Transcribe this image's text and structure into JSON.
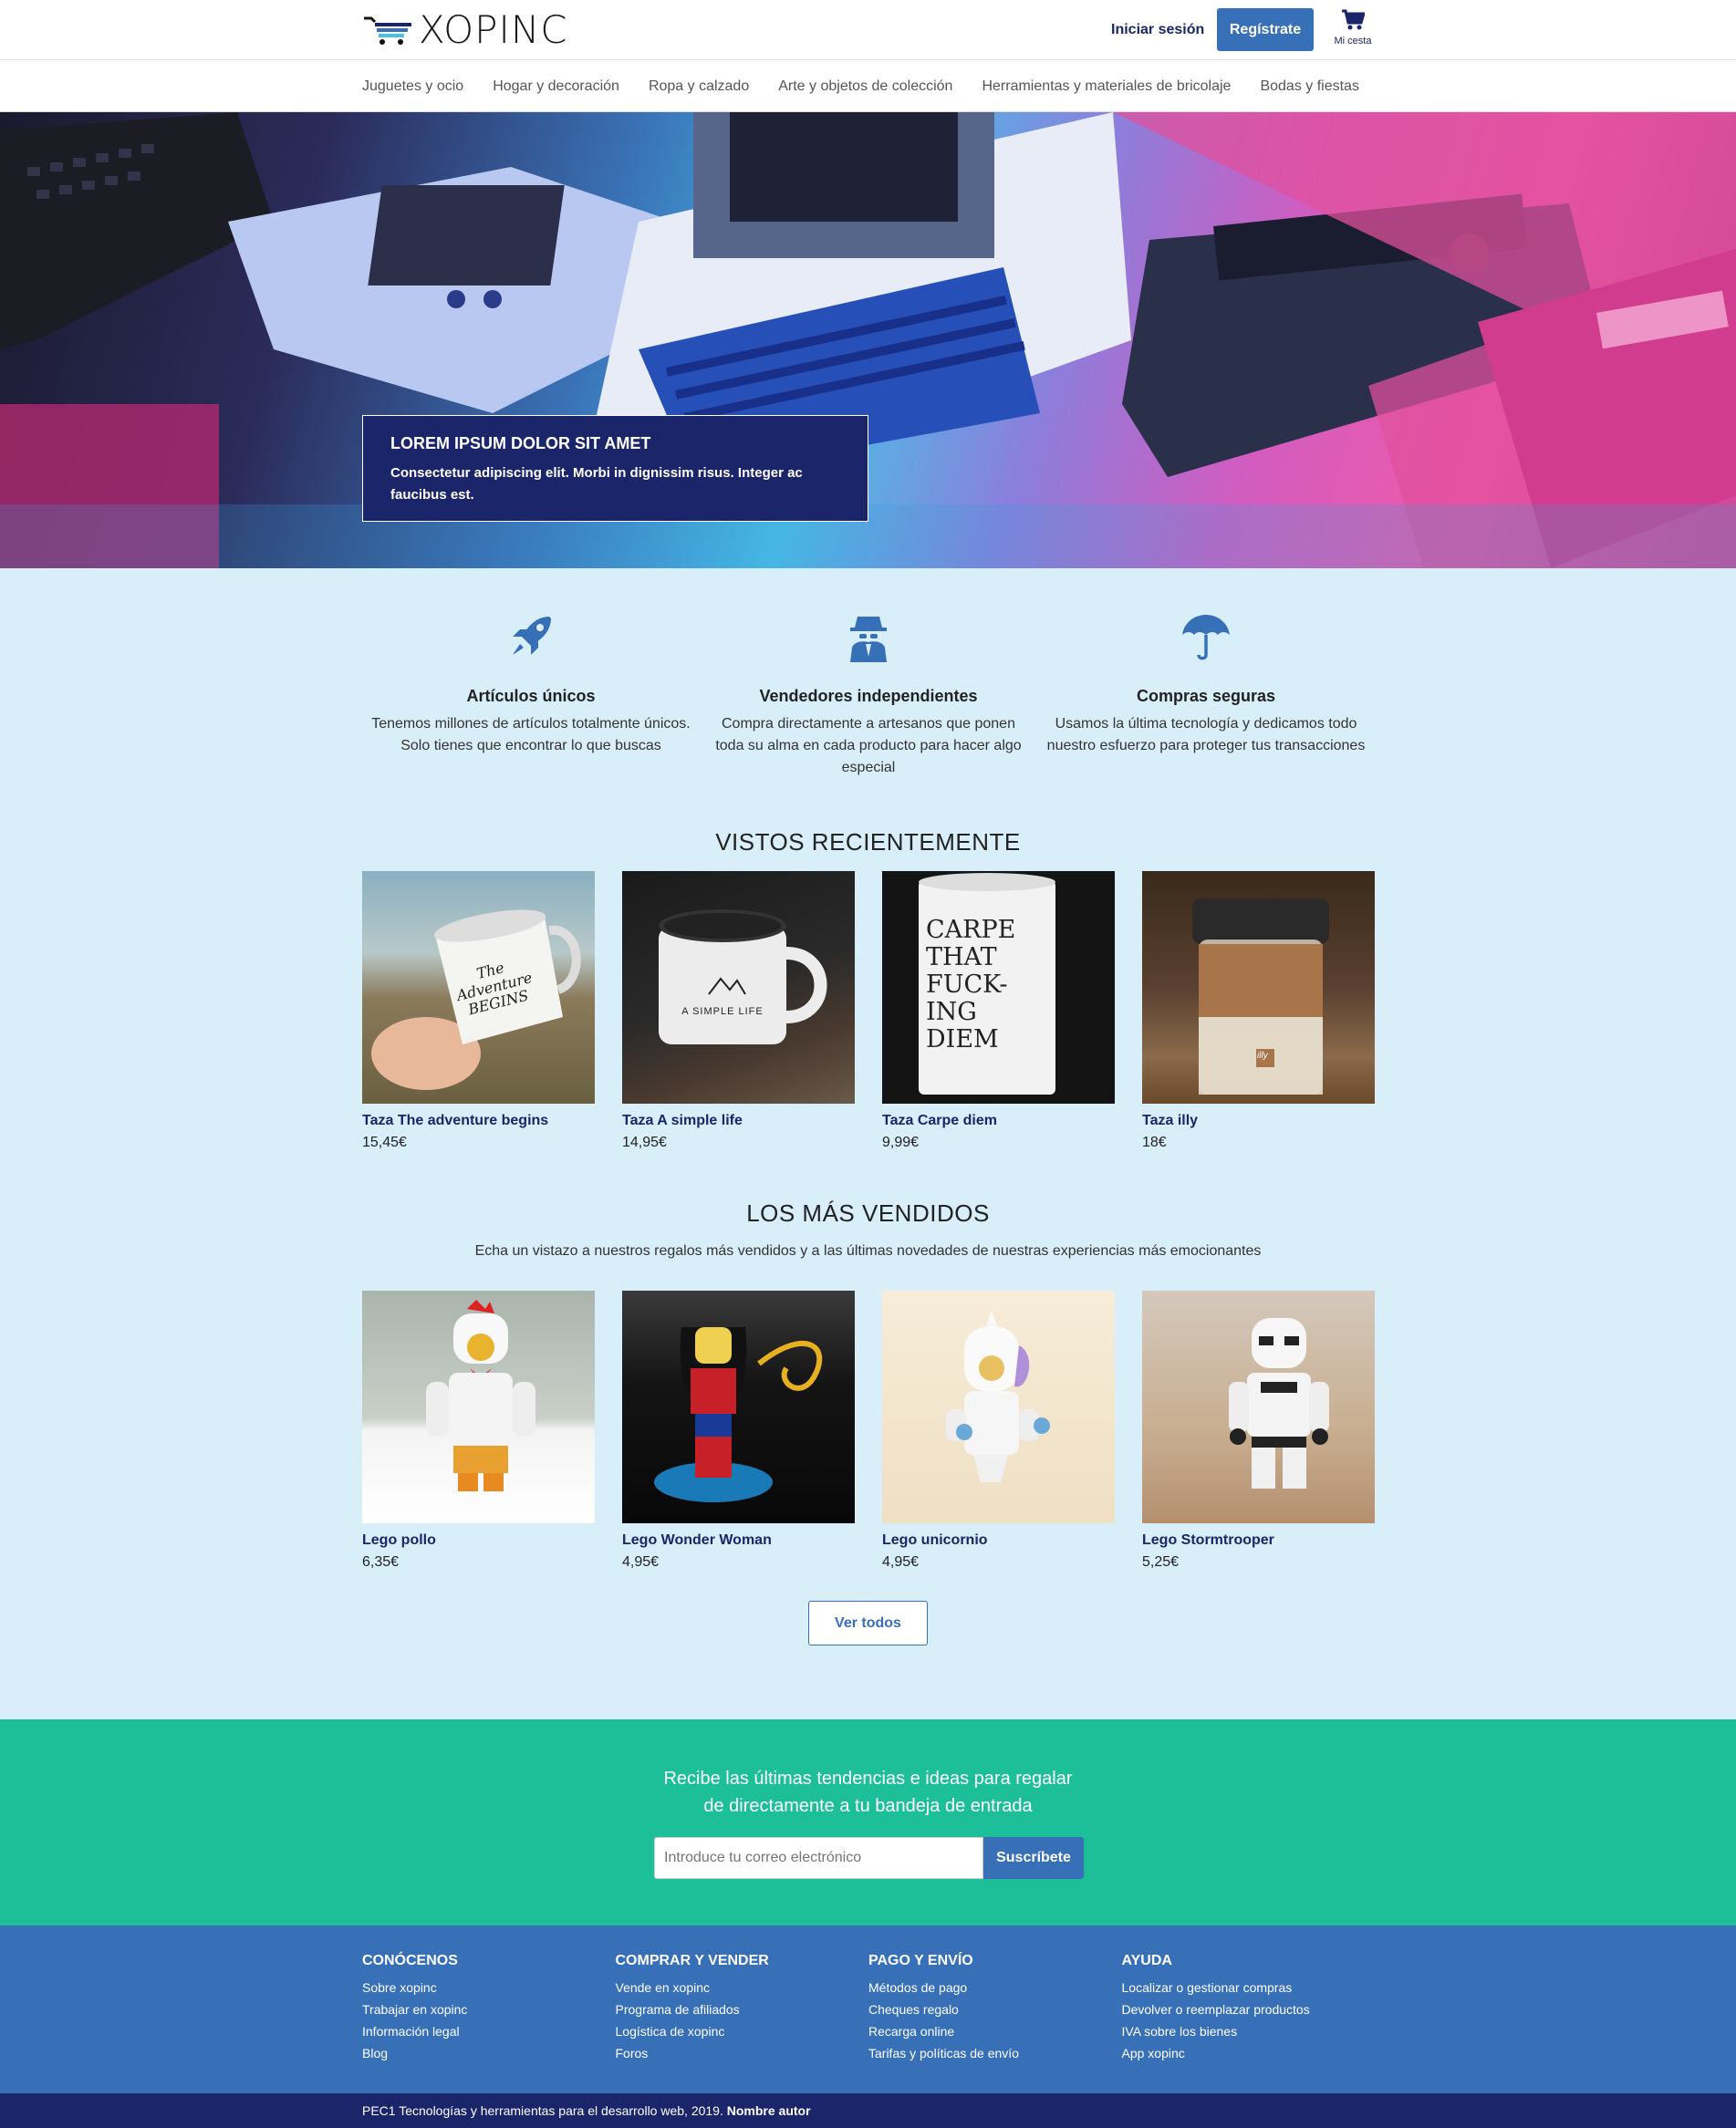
{
  "brand": {
    "name": "XOPINC"
  },
  "header": {
    "login": "Iniciar sesión",
    "register": "Regístrate",
    "cart": "Mi cesta"
  },
  "categories": [
    "Juguetes y ocio",
    "Hogar y decoración",
    "Ropa y calzado",
    "Arte y objetos de colección",
    "Herramientas y materiales de bricolaje",
    "Bodas y fiestas"
  ],
  "hero": {
    "title": "LOREM IPSUM DOLOR SIT AMET",
    "subtitle": "Consectetur adipiscing elit. Morbi in dignissim risus. Integer ac faucibus est."
  },
  "features": [
    {
      "icon": "rocket-icon",
      "title": "Artículos únicos",
      "text": "Tenemos millones de artículos totalmente únicos. Solo tienes que encontrar lo que buscas"
    },
    {
      "icon": "spy-icon",
      "title": "Vendedores independientes",
      "text": "Compra directamente a artesanos que ponen toda su alma en cada producto para hacer algo especial"
    },
    {
      "icon": "umbrella-icon",
      "title": "Compras seguras",
      "text": "Usamos la última tecnología y dedicamos todo nuestro esfuerzo para proteger tus transacciones"
    }
  ],
  "recent": {
    "title": "VISTOS RECIENTEMENTE",
    "items": [
      {
        "name": "Taza The adventure begins",
        "price": "15,45€"
      },
      {
        "name": "Taza A simple life",
        "price": "14,95€"
      },
      {
        "name": "Taza Carpe diem",
        "price": "9,99€"
      },
      {
        "name": "Taza illy",
        "price": "18€"
      }
    ]
  },
  "bestsellers": {
    "title": "LOS MÁS VENDIDOS",
    "subtitle": "Echa un vistazo a nuestros regalos más vendidos y a las últimas novedades de nuestras experiencias más emocionantes",
    "items": [
      {
        "name": "Lego pollo",
        "price": "6,35€"
      },
      {
        "name": "Lego Wonder Woman",
        "price": "4,95€"
      },
      {
        "name": "Lego unicornio",
        "price": "4,95€"
      },
      {
        "name": "Lego Stormtrooper",
        "price": "5,25€"
      }
    ],
    "view_all": "Ver todos"
  },
  "mug_texts": {
    "adventure": "The Adventure BEGINS",
    "simple": "A SIMPLE LIFE",
    "carpe": "CARPE THAT FUCK- ING DIEM",
    "illy": "illy"
  },
  "newsletter": {
    "title_line1": "Recibe las últimas tendencias e ideas para regalar",
    "title_line2": "de directamente a tu bandeja de entrada",
    "placeholder": "Introduce tu correo electrónico",
    "button": "Suscríbete"
  },
  "footer": {
    "columns": [
      {
        "title": "CONÓCENOS",
        "links": [
          "Sobre xopinc",
          "Trabajar en xopinc",
          "Información legal",
          "Blog"
        ]
      },
      {
        "title": "COMPRAR Y VENDER",
        "links": [
          "Vende en xopinc",
          "Programa de afiliados",
          "Logística de xopinc",
          "Foros"
        ]
      },
      {
        "title": "PAGO Y ENVÍO",
        "links": [
          "Métodos de pago",
          "Cheques regalo",
          "Recarga online",
          "Tarifas y políticas de envío"
        ]
      },
      {
        "title": "AYUDA",
        "links": [
          "Localizar o gestionar compras",
          "Devolver o reemplazar productos",
          "IVA sobre los bienes",
          "App xopinc"
        ]
      }
    ],
    "copyright": "PEC1 Tecnologías y herramientas para el desarrollo web, 2019.",
    "author": "Nombre autor"
  },
  "colors": {
    "navy": "#1b2569",
    "blue": "#3770b7",
    "light_bg": "#d8eef9",
    "green": "#1dbf99"
  }
}
